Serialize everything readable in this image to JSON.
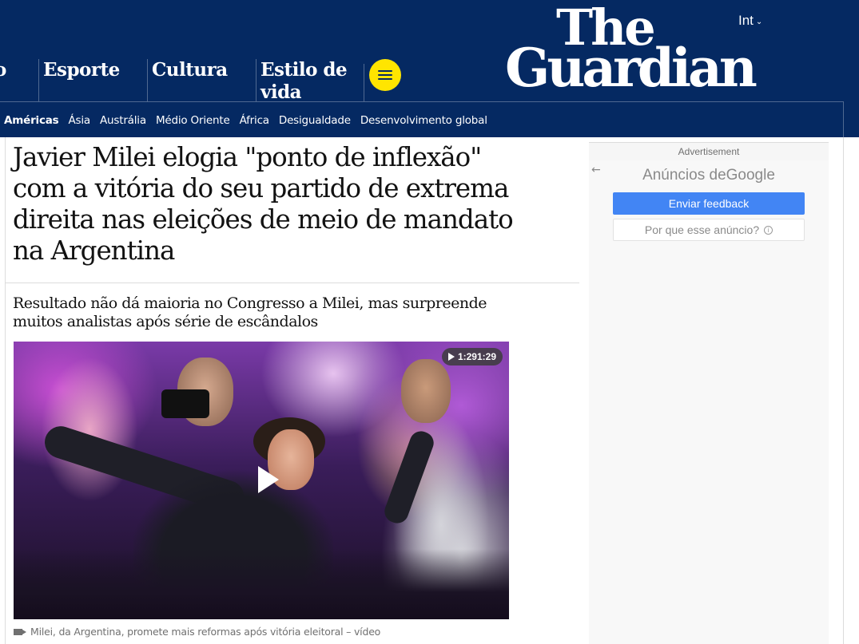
{
  "header": {
    "edition_label": "Int",
    "logo_line1": "The",
    "logo_line2": "Guardian",
    "pillars": [
      {
        "label": "o"
      },
      {
        "label": "Esporte"
      },
      {
        "label": "Cultura"
      },
      {
        "label": "Estilo de vida"
      }
    ],
    "subnav": [
      {
        "label": "Américas",
        "active": true
      },
      {
        "label": "Ásia"
      },
      {
        "label": "Austrália"
      },
      {
        "label": "Médio Oriente"
      },
      {
        "label": "África"
      },
      {
        "label": "Desigualdade"
      },
      {
        "label": "Desenvolvimento global"
      }
    ],
    "brand_color": "#052962",
    "menu_button_color": "#ffe500"
  },
  "article": {
    "headline": "Javier Milei elogia \"ponto de inflexão\" com a vitória do seu partido de extrema direita nas eleições de meio de mandato na Argentina",
    "standfirst": "Resultado não dá maioria no Congresso a Milei, mas surpreende muitos analistas após série de escândalos",
    "video": {
      "duration": "1:291:29",
      "caption": "Milei, da Argentina, promete mais reformas após vitória eleitoral – vídeo"
    }
  },
  "ad": {
    "label": "Advertisement",
    "back_icon": "←",
    "heading_prefix": "Anúncios de",
    "heading_brand": "Google",
    "feedback_button": "Enviar feedback",
    "why_button": "Por que esse anúncio?",
    "feedback_color": "#4285f4"
  }
}
